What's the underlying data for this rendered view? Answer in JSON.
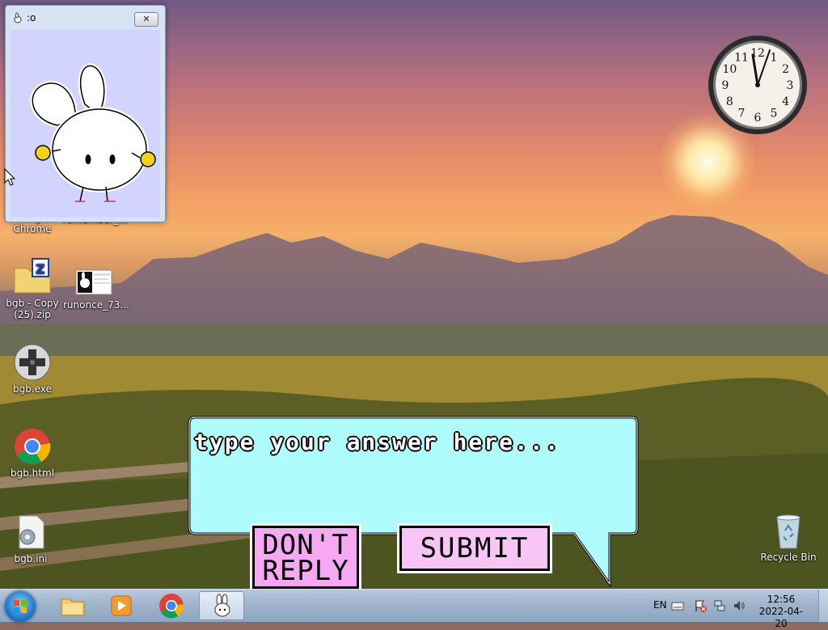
{
  "bunny_window": {
    "title": ":o",
    "close_label": "✕"
  },
  "desktop_icons": [
    {
      "label": "Google\nChrome",
      "icon": "chrome-icon"
    },
    {
      "label": "remember_...",
      "icon": "image-file-icon"
    },
    {
      "label": "bgb - Copy\n(25).zip",
      "icon": "zip-folder-icon"
    },
    {
      "label": "runonce_73...",
      "icon": "image-file-icon"
    },
    {
      "label": "bgb.exe",
      "icon": "gamepad-icon"
    },
    {
      "label": "bgb.html",
      "icon": "chrome-icon"
    },
    {
      "label": "bgb.ini",
      "icon": "settings-file-icon"
    },
    {
      "label": "Recycle Bin",
      "icon": "recycle-bin-icon"
    }
  ],
  "dialog": {
    "placeholder": "type your answer here...",
    "dont_reply_label": "DON'T\nREPLY",
    "submit_label": "SUBMIT"
  },
  "clock": {
    "numerals": [
      "12",
      "1",
      "2",
      "3",
      "4",
      "5",
      "6",
      "7",
      "8",
      "9",
      "10",
      "11"
    ]
  },
  "taskbar": {
    "language": "EN",
    "time": "12:56",
    "date": "2022-04-20",
    "pinned": [
      "explorer-icon",
      "media-player-icon",
      "chrome-icon",
      "bunny-app-icon"
    ]
  },
  "colors": {
    "bubble": "#aefcfc",
    "dont_reply": "#f7a8f3",
    "submit": "#f9c4f6",
    "companion_bg": "#d3d3ff"
  }
}
